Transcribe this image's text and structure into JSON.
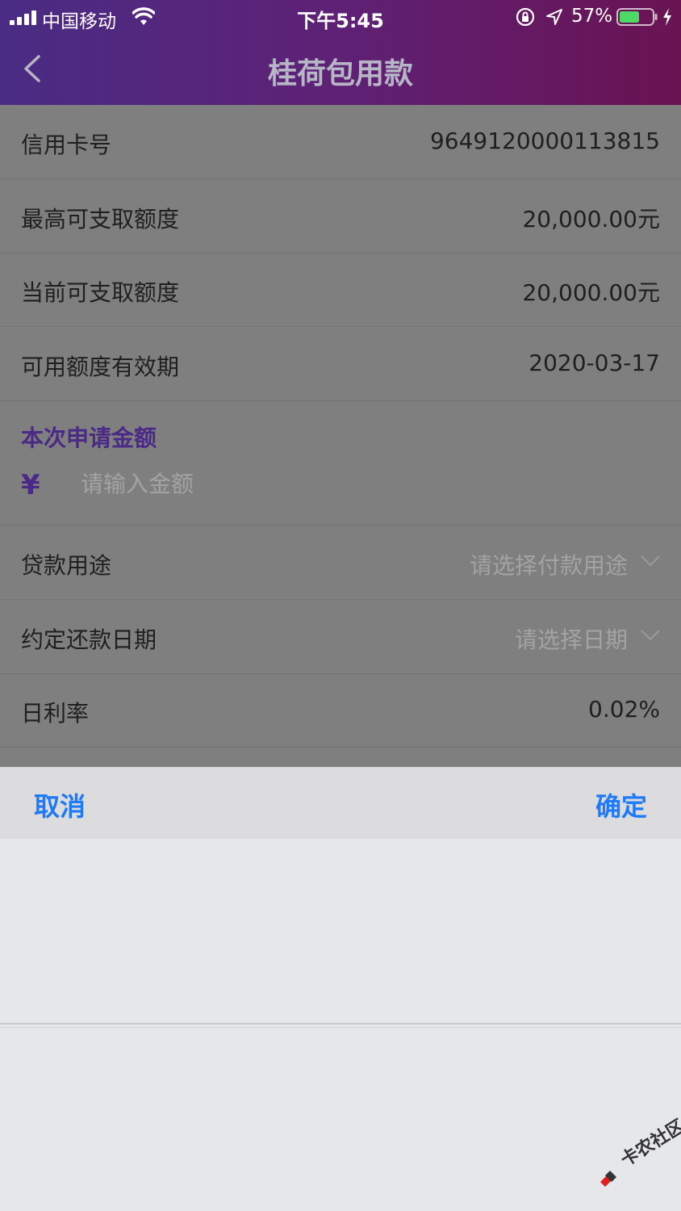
{
  "status_bar": {
    "carrier": "中国移动",
    "time": "下午5:45",
    "battery": "57%"
  },
  "nav": {
    "title": "桂荷包用款"
  },
  "rows": {
    "card_number": {
      "label": "信用卡号",
      "value": "9649120000113815"
    },
    "max_limit": {
      "label": "最高可支取额度",
      "value": "20,000.00元"
    },
    "current_limit": {
      "label": "当前可支取额度",
      "value": "20,000.00元"
    },
    "validity": {
      "label": "可用额度有效期",
      "value": "2020-03-17"
    },
    "purpose": {
      "label": "贷款用途",
      "placeholder": "请选择付款用途"
    },
    "repay_date": {
      "label": "约定还款日期",
      "placeholder": "请选择日期"
    },
    "daily_rate": {
      "label": "日利率",
      "value": "0.02%"
    }
  },
  "amount": {
    "title": "本次申请金额",
    "currency": "¥",
    "placeholder": "请输入金额"
  },
  "picker": {
    "cancel": "取消",
    "confirm": "确定"
  },
  "watermark": {
    "text": "卡农社区"
  },
  "colors": {
    "header_start": "#4a2c84",
    "header_end": "#6a1352",
    "accent_purple": "#4a2a86",
    "ios_blue": "#1e7bf5",
    "overlay_gray": "#7f7f7f"
  }
}
